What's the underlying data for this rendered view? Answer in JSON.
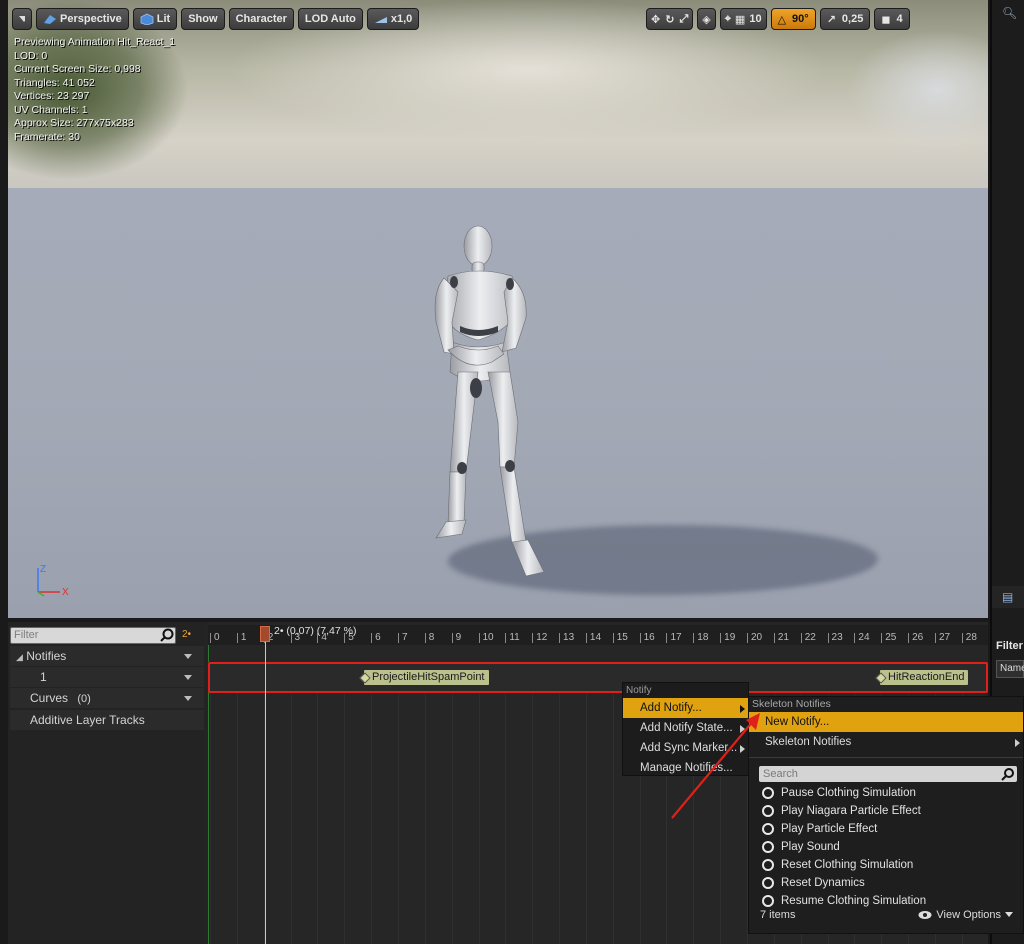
{
  "toolbar": {
    "perspective_label": "Perspective",
    "lit_label": "Lit",
    "show_label": "Show",
    "character_label": "Character",
    "lod_label": "LOD Auto",
    "speed_label": "x1,0",
    "grid_size": "10",
    "angle_snap": "90°",
    "scale_snap": "0,25",
    "camera_speed": "4"
  },
  "info": {
    "lines": [
      "Previewing Animation Hit_React_1",
      "LOD: 0",
      "Current Screen Size: 0,998",
      "Triangles: 41 052",
      "Vertices: 23 297",
      "UV Channels: 1",
      "Approx Size: 277x75x283",
      "Framerate: 30"
    ]
  },
  "axis": {
    "z": "Z",
    "x": "X"
  },
  "timeline": {
    "filter_placeholder": "Filter",
    "frame_badge": "2•",
    "playhead_label": "2• (0,07) (7,47 %)",
    "tracks": {
      "notifies": "Notifies",
      "notify_track_1": "1",
      "curves": "Curves",
      "curves_count": "(0)",
      "additive": "Additive Layer Tracks"
    },
    "ruler": [
      "0",
      "1",
      "2",
      "3",
      "4",
      "5",
      "6",
      "7",
      "8",
      "9",
      "10",
      "11",
      "12",
      "13",
      "14",
      "15",
      "16",
      "17",
      "18",
      "19",
      "20",
      "21",
      "22",
      "23",
      "24",
      "25",
      "26",
      "27",
      "28"
    ],
    "notifies": {
      "first": "ProjectileHitSpamPoint",
      "second": "HitReactionEnd"
    }
  },
  "context_menu": {
    "header": "Notify",
    "items": [
      "Add Notify...",
      "Add Notify State...",
      "Add Sync Marker...",
      "Manage Notifies..."
    ]
  },
  "submenu": {
    "header": "Skeleton Notifies",
    "new_notify": "New Notify...",
    "skeleton_notifies": "Skeleton Notifies",
    "search_placeholder": "Search",
    "items": [
      "Pause Clothing Simulation",
      "Play Niagara Particle Effect",
      "Play Particle Effect",
      "Play Sound",
      "Reset Clothing Simulation",
      "Reset Dynamics",
      "Resume Clothing Simulation"
    ],
    "count": "7 items",
    "view_options": "View Options"
  },
  "right_panel": {
    "filter_label": "Filter",
    "name_label": "Name"
  },
  "colors": {
    "accent": "#e1a20f",
    "highlight_box": "#e0201a",
    "arrow": "#e0201a"
  }
}
